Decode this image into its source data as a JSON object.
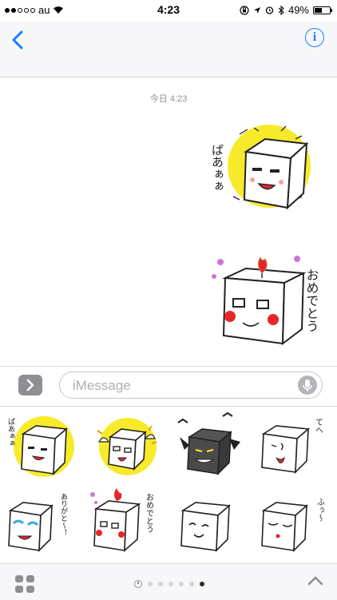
{
  "status_bar": {
    "carrier": "au",
    "time": "4:23",
    "battery_percent": "49%",
    "signal_bars_filled": 2,
    "battery_level": 0.49
  },
  "nav": {
    "back_icon": "chevron-left-icon",
    "info_label": "i"
  },
  "conversation": {
    "timestamp": "今日 4:23",
    "messages": [
      {
        "sticker": "tofu-paa",
        "caption": "ぱあぁぁ"
      },
      {
        "sticker": "tofu-candle",
        "caption": "おめでとう"
      }
    ]
  },
  "input_bar": {
    "apps_icon": "chevron-right-icon",
    "placeholder": "iMessage",
    "mic_icon": "microphone-icon"
  },
  "drawer": {
    "stickers": [
      {
        "id": "tofu-paa",
        "caption": "ぱあぁぁ"
      },
      {
        "id": "tofu-angel",
        "caption": ""
      },
      {
        "id": "tofu-devil",
        "caption": ""
      },
      {
        "id": "tofu-tehe",
        "caption": "てへ"
      },
      {
        "id": "tofu-thanks",
        "caption": "ありがと〜！"
      },
      {
        "id": "tofu-candle",
        "caption": "おめでとう"
      },
      {
        "id": "tofu-smile",
        "caption": ""
      },
      {
        "id": "tofu-fuu",
        "caption": "ふぅ〜"
      }
    ]
  },
  "bottom_bar": {
    "grid_icon": "app-grid-icon",
    "recent_icon": "clock-icon",
    "page_count": 7,
    "active_page": 7,
    "expand_icon": "chevron-up-icon"
  },
  "colors": {
    "accent": "#1a7dff",
    "sticker_yellow": "#f7ea2a",
    "sticker_red": "#e8262a",
    "sticker_pink": "#cf74d6"
  }
}
